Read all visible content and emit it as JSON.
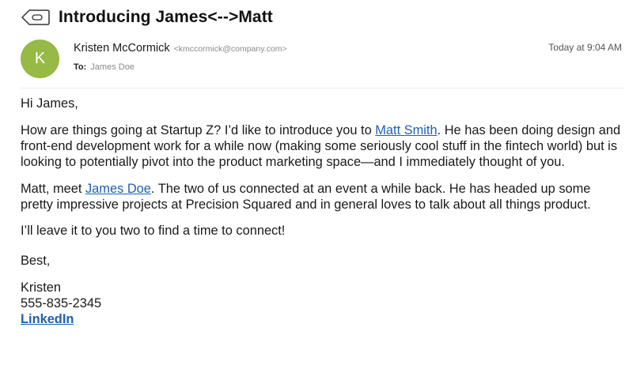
{
  "email": {
    "subject": "Introducing James<-->Matt",
    "avatar_initial": "K",
    "sender_name": "Kristen McCormick",
    "sender_email": "<kmccormick@company.com>",
    "to_label": "To:",
    "to_name": "James Doe",
    "timestamp": "Today at 9:04 AM"
  },
  "body": {
    "greeting": "Hi James,",
    "para1": {
      "before_link": "How are things going at Startup Z? I’d like to introduce you to ",
      "link": "Matt Smith",
      "after_link": ". He has been doing design and front-end development work for a while now (making some seriously cool stuff in the fintech world) but is looking to potentially pivot into the product marketing space—and I immediately thought of you."
    },
    "para2": {
      "before_link": "Matt, meet ",
      "link": "James Doe",
      "after_link": ". The two of us connected at an event a while back. He has headed up some pretty impressive projects at Precision Squared and in general loves to talk about all things product."
    },
    "para3": "I’ll leave it to you two to find a time to connect!",
    "closing": "Best,",
    "signature": {
      "name": "Kristen",
      "phone": "555-835-2345",
      "linkedin": "LinkedIn"
    }
  },
  "colors": {
    "avatar": "#97b946",
    "link": "#1f5fb5"
  }
}
